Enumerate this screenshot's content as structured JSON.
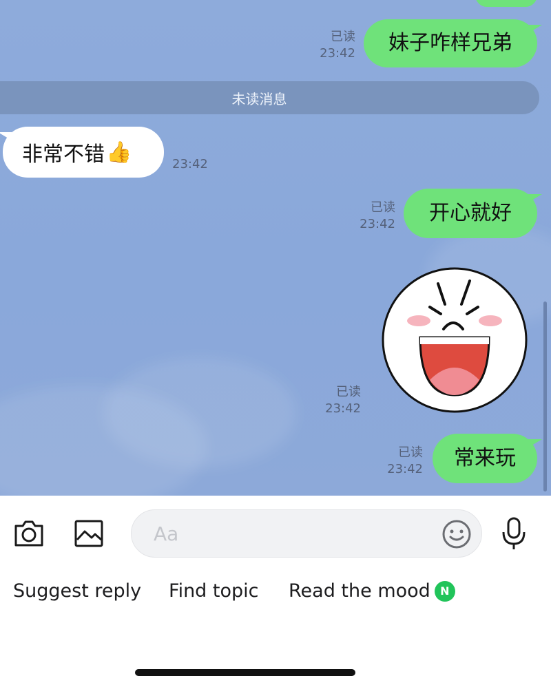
{
  "chat": {
    "top_partial_bubble": "",
    "unread_divider": "未读消息",
    "messages": [
      {
        "direction": "out",
        "text": "妹子咋样兄弟",
        "read": "已读",
        "time": "23:42"
      },
      {
        "direction": "in",
        "text": "非常不错",
        "emoji": "👍",
        "time": "23:42"
      },
      {
        "direction": "out",
        "text": "开心就好",
        "read": "已读",
        "time": "23:42"
      },
      {
        "direction": "out",
        "sticker": "laughing-face-sticker",
        "read": "已读",
        "time": "23:42"
      },
      {
        "direction": "out",
        "text": "常来玩",
        "read": "已读",
        "time": "23:42"
      }
    ]
  },
  "composer": {
    "camera_icon": "camera-icon",
    "gallery_icon": "image-icon",
    "input_placeholder": "Aa",
    "emoji_icon": "smiley-icon",
    "mic_icon": "microphone-icon"
  },
  "quick_actions": [
    {
      "label": "Suggest reply"
    },
    {
      "label": "Find topic"
    },
    {
      "label": "Read the mood",
      "badge": "N"
    }
  ],
  "colors": {
    "chat_background": "#8eabdb",
    "outgoing_bubble": "#6fe27a",
    "incoming_bubble": "#ffffff",
    "new_badge": "#21c45a"
  }
}
